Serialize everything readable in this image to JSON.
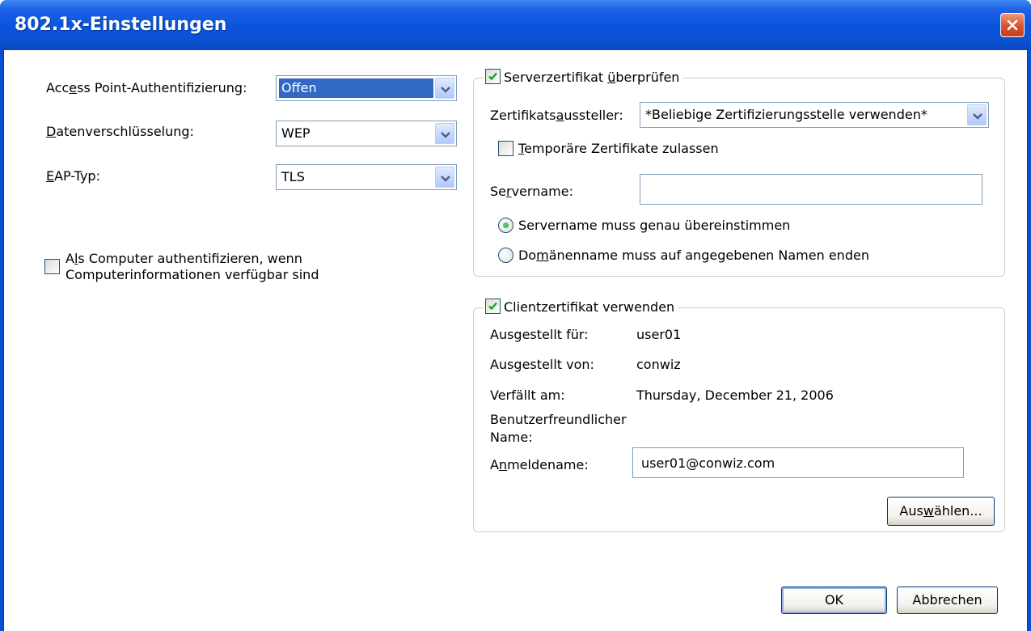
{
  "window": {
    "title": "802.1x-Einstellungen"
  },
  "left": {
    "ap_auth": {
      "label_pre": "Acc",
      "label_key": "e",
      "label_post": "ss Point-Authentifizierung:",
      "value": "Offen"
    },
    "encryption": {
      "label_key": "D",
      "label_post": "atenverschlüsselung:",
      "value": "WEP"
    },
    "eap": {
      "label_key": "E",
      "label_post": "AP-Typ:",
      "value": "TLS"
    },
    "computer_auth": {
      "line1_pre": "A",
      "line1_key": "l",
      "line1_post": "s Computer authentifizieren, wenn",
      "line2": "Computerinformationen verfügbar sind",
      "checked": false
    }
  },
  "server_group": {
    "legend_pre": "Serverzertifikat ",
    "legend_key": "ü",
    "legend_post": "berprüfen",
    "checked": true,
    "issuer_label_pre": "Zertifikats",
    "issuer_label_key": "a",
    "issuer_label_post": "ussteller:",
    "issuer_value": "*Beliebige Zertifizierungsstelle verwenden*",
    "temp_pre": "",
    "temp_key": "T",
    "temp_post": "emporäre Zertifikate zulassen",
    "temp_checked": false,
    "servername_label_pre": "Se",
    "servername_label_key": "r",
    "servername_label_post": "vername:",
    "servername_value": "",
    "radio1_pre": "Servername muss ",
    "radio1_key": "g",
    "radio1_post": "enau übereinstimmen",
    "radio2_pre": "Do",
    "radio2_key": "m",
    "radio2_post": "änenname muss auf angegebenen Namen enden",
    "radio_selected": 1
  },
  "client_group": {
    "legend_pre": "Clientzertif",
    "legend_key": "i",
    "legend_post": "kat verwenden",
    "checked": true,
    "issued_to_label": "Ausgestellt für:",
    "issued_to_value": "user01",
    "issued_by_label": "Ausgestellt von:",
    "issued_by_value": "conwiz",
    "expires_label": "Verfällt am:",
    "expires_value": "Thursday, December 21, 2006",
    "friendly_label_1": "Benutzerfreundlicher",
    "friendly_label_2": "Name:",
    "login_label_pre": "A",
    "login_label_key": "n",
    "login_label_post": "meldename:",
    "login_value": "user01@conwiz.com",
    "select_pre": "Aus",
    "select_key": "w",
    "select_post": "ählen..."
  },
  "buttons": {
    "ok": "OK",
    "cancel": "Abbrechen"
  }
}
